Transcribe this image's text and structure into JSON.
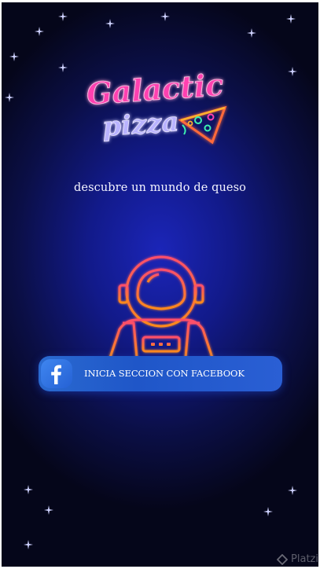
{
  "logo": {
    "word1": "Galactic",
    "word2": "pizza",
    "colors": {
      "word1": "#ff3fb0",
      "word2": "#b9b3ff",
      "slice": "#ff6a3a",
      "neon_green": "#3cf0b0"
    }
  },
  "tagline": "descubre un mundo de queso",
  "illustration": {
    "name": "astronaut-icon",
    "color": "#ff6a1a"
  },
  "facebook_button": {
    "label": "INICIA SECCION CON FACEBOOK",
    "icon": "facebook-icon",
    "color": "#2a62d4"
  },
  "watermark": {
    "text": "Platzi",
    "icon": "platzi-icon"
  },
  "background": {
    "center": "#1b25b8",
    "edge": "#05061a"
  }
}
